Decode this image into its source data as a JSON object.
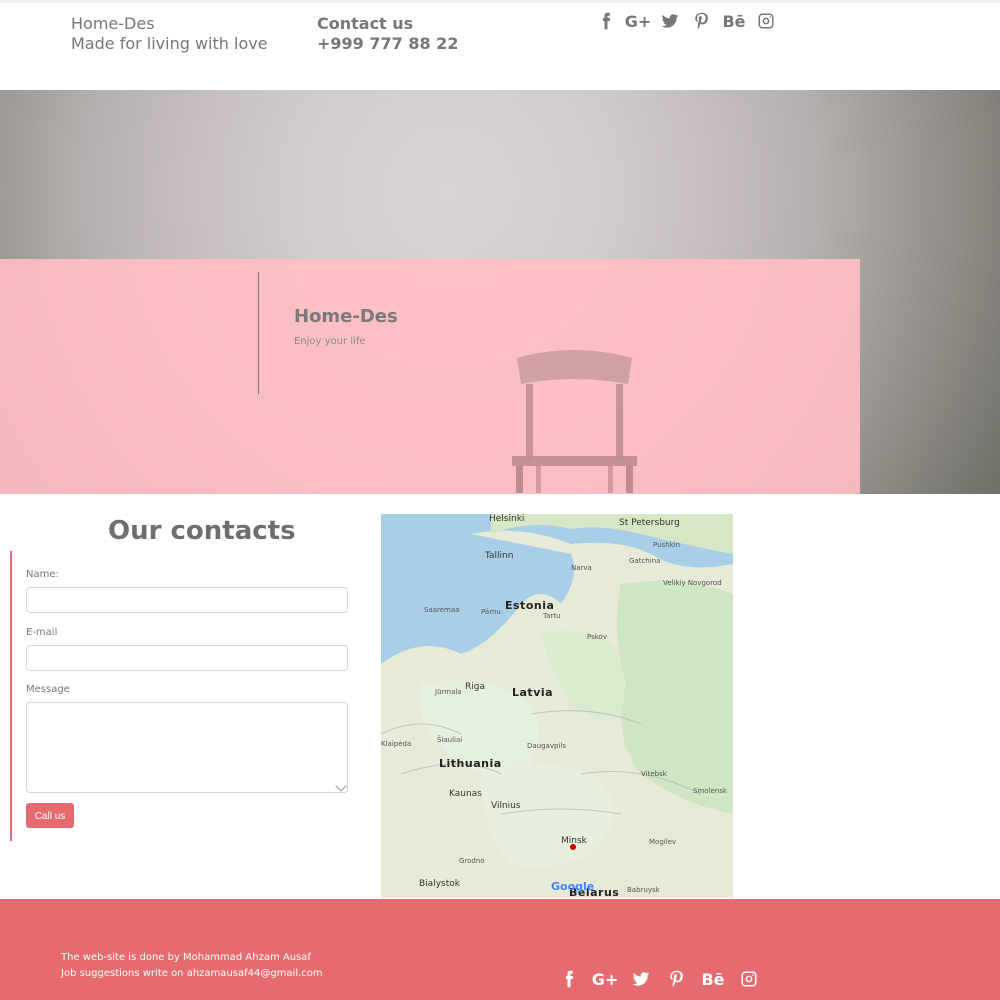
{
  "header": {
    "brand_name": "Home-Des",
    "brand_tagline": "Made for living with love",
    "contact_title": "Contact us",
    "contact_phone": "+999 777 88 22",
    "social_icons": [
      "facebook-icon",
      "google-plus-icon",
      "twitter-icon",
      "pinterest-icon",
      "behance-icon",
      "instagram-icon"
    ]
  },
  "hero": {
    "title": "Home-Des",
    "subtitle": "Enjoy your life",
    "overlay_color": "#ffc2c6"
  },
  "contacts": {
    "title": "Our contacts",
    "name_label": "Name:",
    "email_label": "E-mail",
    "message_label": "Message",
    "button_label": "Call us",
    "accent_color": "#e56b70"
  },
  "map": {
    "labels": [
      {
        "text": "Helsinki",
        "cls": "mlabel"
      },
      {
        "text": "St Petersburg",
        "cls": "mlabel"
      },
      {
        "text": "Tallinn",
        "cls": "mlabel"
      },
      {
        "text": "Estonia",
        "cls": "mlabel mbig"
      },
      {
        "text": "Latvia",
        "cls": "mlabel mbig"
      },
      {
        "text": "Riga",
        "cls": "mlabel"
      },
      {
        "text": "Lithuania",
        "cls": "mlabel mbig"
      },
      {
        "text": "Kaunas",
        "cls": "mlabel"
      },
      {
        "text": "Vilnius",
        "cls": "mlabel"
      },
      {
        "text": "Minsk",
        "cls": "mlabel"
      },
      {
        "text": "Belarus",
        "cls": "mlabel mbig"
      },
      {
        "text": "Bialystok",
        "cls": "mlabel"
      },
      {
        "text": "Pskov",
        "cls": "mlabel msmall"
      },
      {
        "text": "Velikiy Novgorod",
        "cls": "mlabel msmall"
      },
      {
        "text": "Daugavpils",
        "cls": "mlabel msmall"
      },
      {
        "text": "Vitebsk",
        "cls": "mlabel msmall"
      },
      {
        "text": "Smolensk",
        "cls": "mlabel msmall"
      },
      {
        "text": "Mogilev",
        "cls": "mlabel msmall"
      },
      {
        "text": "Grodno",
        "cls": "mlabel msmall"
      },
      {
        "text": "Babruysk",
        "cls": "mlabel msmall"
      },
      {
        "text": "Narva",
        "cls": "mlabel msmall"
      },
      {
        "text": "Gatchina",
        "cls": "mlabel msmall"
      },
      {
        "text": "Pushkin",
        "cls": "mlabel msmall"
      },
      {
        "text": "Saaremaa",
        "cls": "mlabel msmall"
      },
      {
        "text": "Pärnu",
        "cls": "mlabel msmall"
      },
      {
        "text": "Tartu",
        "cls": "mlabel msmall"
      },
      {
        "text": "Jūrmala",
        "cls": "mlabel msmall"
      },
      {
        "text": "Šiauliai",
        "cls": "mlabel msmall"
      },
      {
        "text": "Klaipėda",
        "cls": "mlabel msmall"
      }
    ],
    "logo": "Google"
  },
  "footer": {
    "credit_line": "The web-site is done by Mohammad Ahzam Ausaf",
    "email_line": "Job suggestions write on ahzamausaf44@gmail.com",
    "social_icons": [
      "facebook-icon",
      "google-plus-icon",
      "twitter-icon",
      "pinterest-icon",
      "behance-icon",
      "instagram-icon"
    ]
  }
}
